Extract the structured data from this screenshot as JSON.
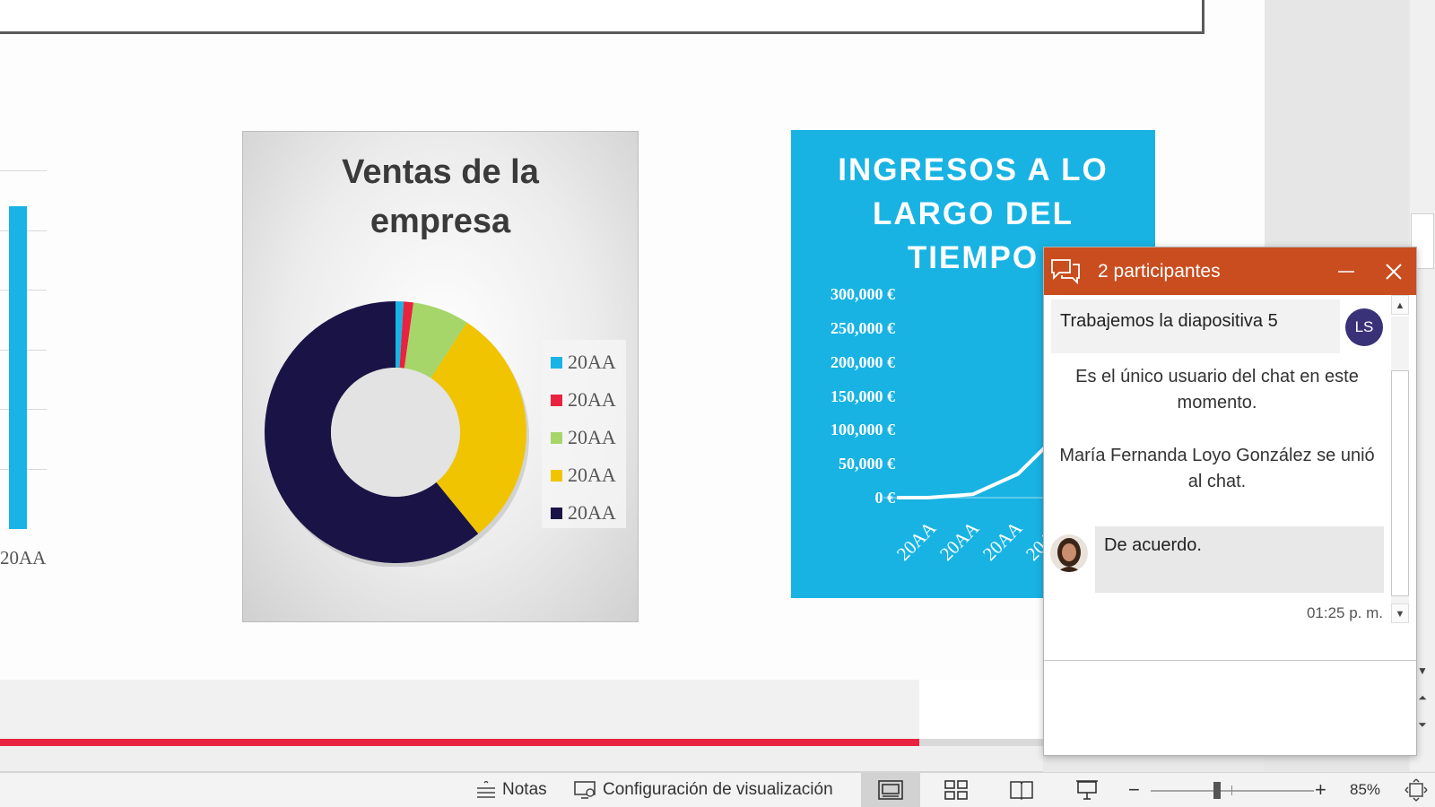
{
  "left_chart": {
    "x_label": "20AA"
  },
  "donut_card": {
    "title_line1": "Ventas de la",
    "title_line2": "empresa",
    "chart_data": {
      "type": "pie",
      "donut": true,
      "slices": [
        {
          "label": "20AA",
          "value": 1,
          "color": "#1ab3e6"
        },
        {
          "label": "20AA",
          "value": 1.2,
          "color": "#e8233f"
        },
        {
          "label": "20AA",
          "value": 7,
          "color": "#a6d66a"
        },
        {
          "label": "20AA",
          "value": 30,
          "color": "#f0c400"
        },
        {
          "label": "20AA",
          "value": 61,
          "color": "#1a1446"
        }
      ],
      "legend_position": "right"
    }
  },
  "income_card": {
    "title_line1": "INGRESOS A LO",
    "title_line2": "LARGO DEL",
    "title_line3": "TIEMPO",
    "chart_data": {
      "type": "line",
      "y_ticks": [
        "300,000 €",
        "250,000 €",
        "200,000 €",
        "150,000 €",
        "100,000 €",
        "50,000 €",
        "0 €"
      ],
      "ylim": [
        0,
        300000
      ],
      "x_ticks": [
        "20AA",
        "20AA",
        "20AA",
        "20AA"
      ],
      "values": [
        0,
        5000,
        35000,
        100000
      ],
      "color": "#ffffff"
    }
  },
  "status_bar": {
    "notes_label": "Notas",
    "display_settings_label": "Configuración de visualización",
    "zoom_minus": "−",
    "zoom_plus": "+",
    "zoom_level": "85%"
  },
  "chat": {
    "header_title": "2 participantes",
    "top_message": "Trabajemos la diapositiva 5",
    "top_avatar_initials": "LS",
    "system_msg_1": "Es el único usuario del chat en este momento.",
    "system_msg_2": "María Fernanda  Loyo González se unió al chat.",
    "reply_message": "De acuerdo.",
    "reply_time": "01:25 p. m."
  },
  "colors": {
    "chat_header": "#c94d1f",
    "progress": "#e8233f",
    "income_bg": "#18b3e3",
    "avatar_ls": "#3a3279"
  }
}
